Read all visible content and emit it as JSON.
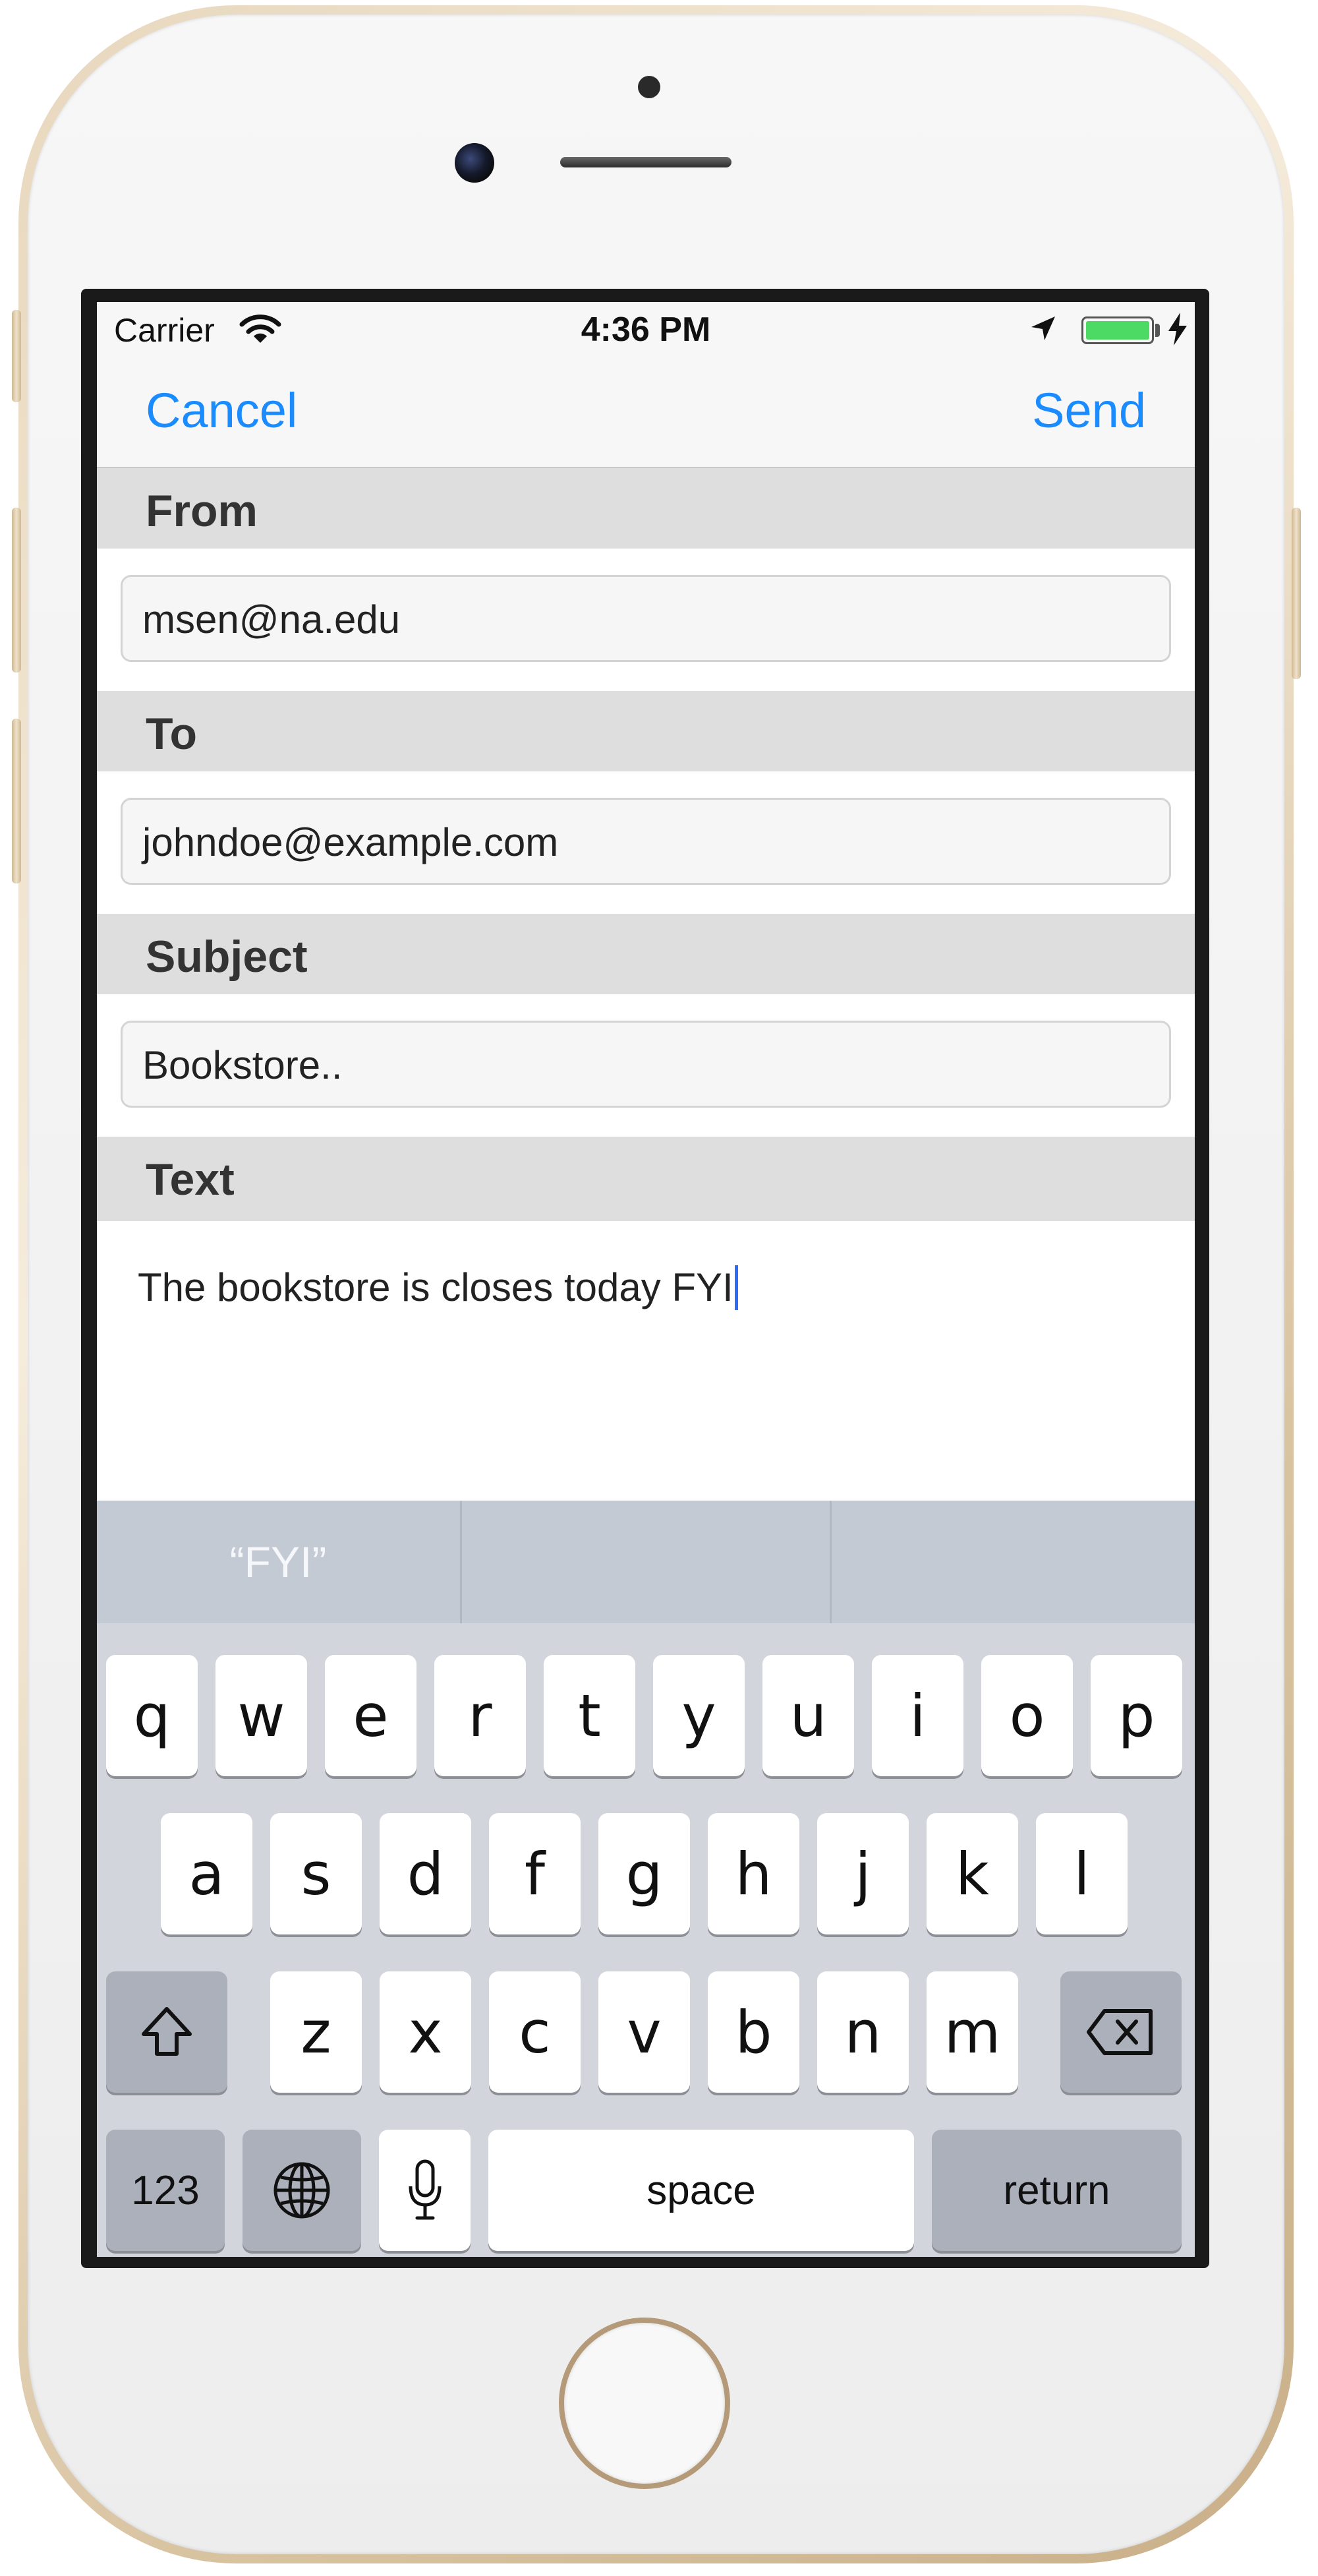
{
  "status_bar": {
    "carrier": "Carrier",
    "time": "4:36 PM"
  },
  "nav": {
    "cancel": "Cancel",
    "send": "Send"
  },
  "form": {
    "from_label": "From",
    "from_value": "msen@na.edu",
    "to_label": "To",
    "to_value": "johndoe@example.com",
    "subject_label": "Subject",
    "subject_value": "Bookstore..",
    "text_label": "Text",
    "text_value": "The bookstore is closes today FYI"
  },
  "keyboard": {
    "suggestions": [
      "“FYI”",
      "",
      ""
    ],
    "row1": [
      "q",
      "w",
      "e",
      "r",
      "t",
      "y",
      "u",
      "i",
      "o",
      "p"
    ],
    "row2": [
      "a",
      "s",
      "d",
      "f",
      "g",
      "h",
      "j",
      "k",
      "l"
    ],
    "row3": [
      "z",
      "x",
      "c",
      "v",
      "b",
      "n",
      "m"
    ],
    "numbers_key": "123",
    "space_key": "space",
    "return_key": "return"
  },
  "colors": {
    "accent": "#1a8cff",
    "battery": "#4cd964",
    "caret": "#2f6cf1"
  },
  "icons": {
    "status": [
      "wifi-icon",
      "location-arrow-icon",
      "battery-icon",
      "charging-bolt-icon"
    ],
    "keyboard": [
      "shift-icon",
      "delete-icon",
      "globe-icon",
      "microphone-icon"
    ]
  }
}
